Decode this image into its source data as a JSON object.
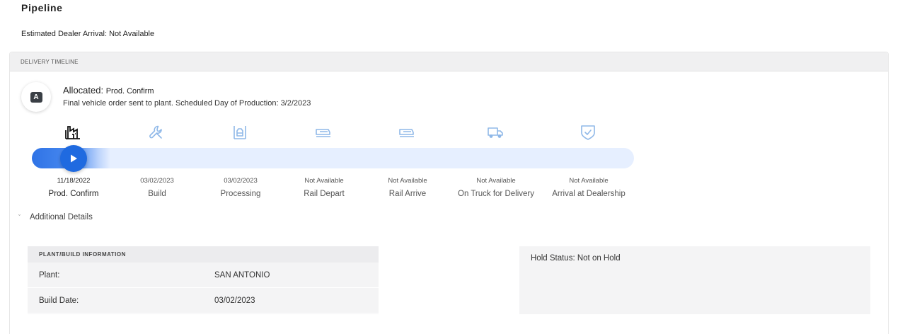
{
  "page": {
    "title": "Pipeline",
    "eta_label": "Estimated Dealer Arrival:",
    "eta_value": "Not Available"
  },
  "timeline": {
    "header": "DELIVERY TIMELINE",
    "status_badge": "A",
    "status_title": "Allocated:",
    "status_stage": "Prod. Confirm",
    "status_description": "Final vehicle order sent to plant. Scheduled Day of Production: 3/2/2023",
    "progress_fraction": 0.13,
    "current_step_index": 0,
    "steps": [
      {
        "label": "Prod. Confirm",
        "date": "11/18/2022",
        "icon": "factory-icon"
      },
      {
        "label": "Build",
        "date": "03/02/2023",
        "icon": "wrench-icon"
      },
      {
        "label": "Processing",
        "date": "03/02/2023",
        "icon": "processing-icon"
      },
      {
        "label": "Rail Depart",
        "date": "Not Available",
        "icon": "rail-depart-icon"
      },
      {
        "label": "Rail Arrive",
        "date": "Not Available",
        "icon": "rail-arrive-icon"
      },
      {
        "label": "On Truck for Delivery",
        "date": "Not Available",
        "icon": "truck-icon"
      },
      {
        "label": "Arrival at Dealership",
        "date": "Not Available",
        "icon": "shield-check-icon"
      }
    ]
  },
  "details": {
    "toggle_label": "Additional Details",
    "plant_header": "PLANT/BUILD INFORMATION",
    "rows": [
      {
        "key": "Plant:",
        "value": "SAN ANTONIO"
      },
      {
        "key": "Build Date:",
        "value": "03/02/2023"
      }
    ],
    "hold_label": "Hold Status:",
    "hold_value": "Not on Hold"
  },
  "colors": {
    "accent": "#1f6ae0",
    "track": "#e6efff",
    "icon_inactive": "#8fb8e8",
    "icon_active": "#111111"
  }
}
